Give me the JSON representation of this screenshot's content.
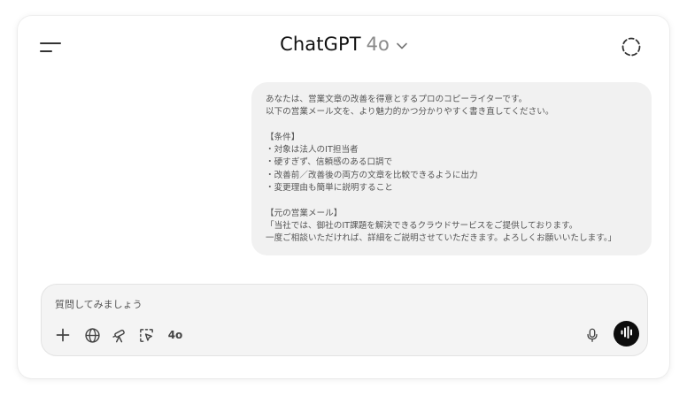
{
  "header": {
    "app_title": "ChatGPT",
    "model_name": "4o",
    "icons": {
      "menu": "sidebar-menu-icon",
      "model_chevron": "chevron-down-icon",
      "temporary_chat": "temporary-chat-icon"
    }
  },
  "conversation": {
    "user_message": {
      "lines": [
        "あなたは、営業文章の改善を得意とするプロのコピーライターです。",
        "以下の営業メール文を、より魅力的かつ分かりやすく書き直してください。",
        "",
        "【条件】",
        "・対象は法人のIT担当者",
        "・硬すぎず、信頼感のある口調で",
        "・改善前／改善後の両方の文章を比較できるように出力",
        "・変更理由も簡単に説明すること",
        "",
        "【元の営業メール】",
        "「当社では、御社のIT課題を解決できるクラウドサービスをご提供しております。",
        "一度ご相談いただければ、詳細をご説明させていただきます。よろしくお願いいたします。」"
      ]
    }
  },
  "composer": {
    "placeholder": "質問してみましょう",
    "value": "",
    "model_label": "4o",
    "icons": {
      "add": "plus-icon",
      "search": "globe-icon",
      "research": "telescope-icon",
      "operator": "cursor-select-icon",
      "dictate": "microphone-icon",
      "voice": "voice-waveform-icon"
    }
  },
  "colors": {
    "user_bubble_bg": "#f1f1f1",
    "composer_bg": "#f4f4f4",
    "voice_button_bg": "#0d0d0d",
    "muted_text": "#8a8a8a"
  }
}
